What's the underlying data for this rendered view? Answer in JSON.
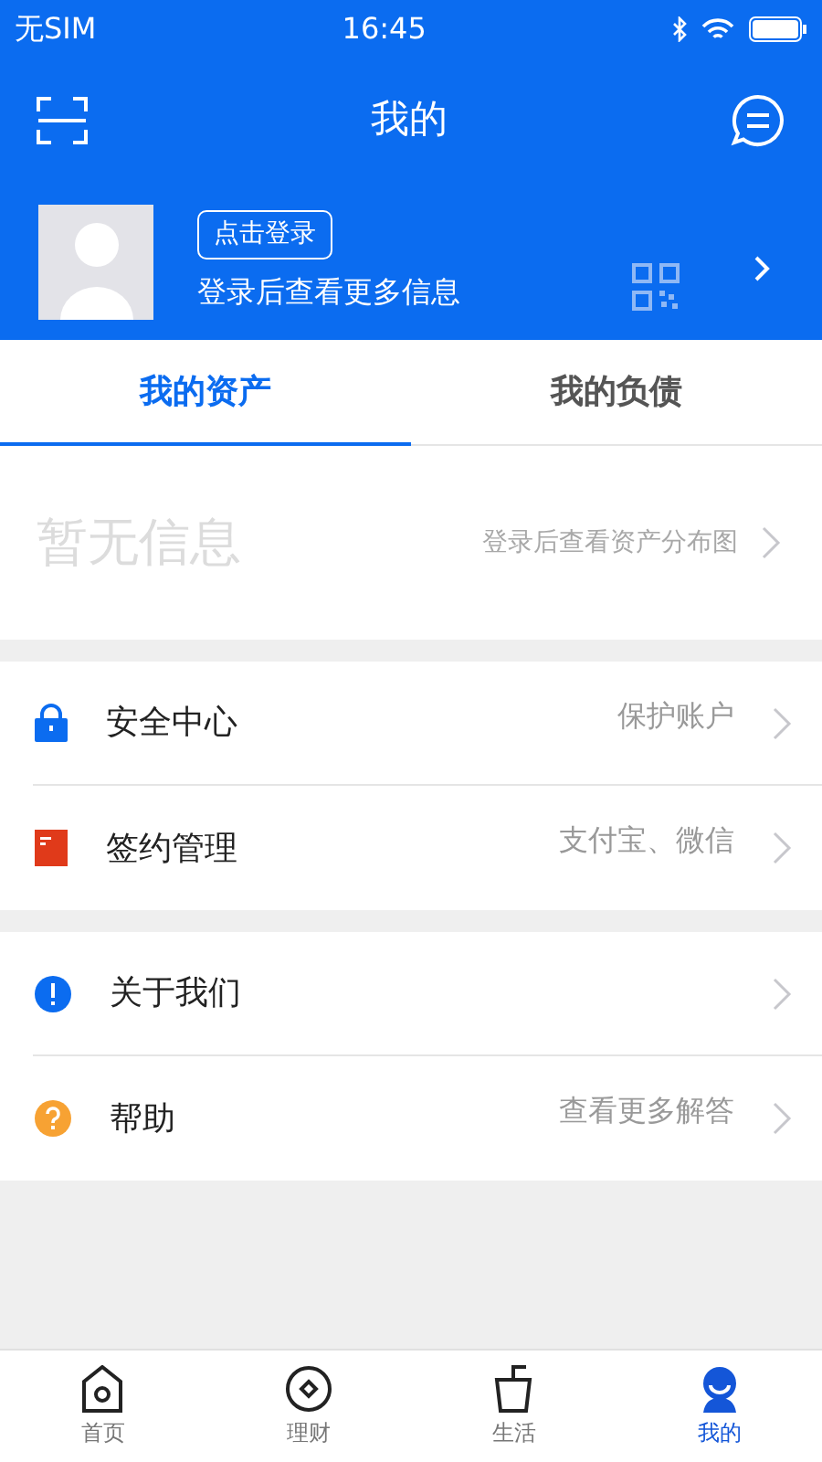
{
  "status_bar": {
    "carrier": "无SIM",
    "time": "16:45"
  },
  "nav": {
    "title": "我的"
  },
  "profile": {
    "login_button": "点击登录",
    "hint": "登录后查看更多信息"
  },
  "tabs": [
    {
      "label": "我的资产",
      "selected": true
    },
    {
      "label": "我的负债",
      "selected": false
    }
  ],
  "assets": {
    "empty_text": "暂无信息",
    "link": "登录后查看资产分布图"
  },
  "menu_groups": [
    [
      {
        "kind": "lock",
        "label": "安全中心",
        "detail": "保护账户"
      },
      {
        "kind": "contract",
        "label": "签约管理",
        "detail": "支付宝、微信"
      }
    ],
    [
      {
        "kind": "info",
        "label": "关于我们"
      },
      {
        "kind": "help",
        "label": "帮助",
        "detail": "查看更多解答"
      }
    ]
  ],
  "tab_bar": [
    {
      "kind": "home",
      "label": "首页",
      "selected": false
    },
    {
      "kind": "finance",
      "label": "理财",
      "selected": false
    },
    {
      "kind": "life",
      "label": "生活",
      "selected": false
    },
    {
      "kind": "me",
      "label": "我的",
      "selected": true
    }
  ]
}
